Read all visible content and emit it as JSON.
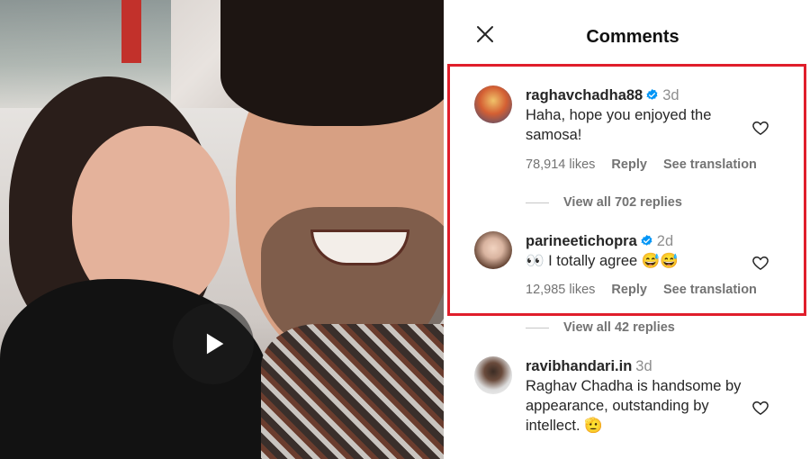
{
  "panel": {
    "title": "Comments"
  },
  "comments": [
    {
      "username": "raghavchadha88",
      "time": "3d",
      "text": "Haha, hope you enjoyed the samosa!",
      "likes": "78,914 likes",
      "reply": "Reply",
      "see_translation": "See translation",
      "view_replies": "View all 702 replies",
      "verified": true
    },
    {
      "username": "parineetichopra",
      "time": "2d",
      "text": "👀 I totally agree 😅😅",
      "likes": "12,985 likes",
      "reply": "Reply",
      "see_translation": "See translation",
      "view_replies": "View all 42 replies",
      "verified": true
    },
    {
      "username": "ravibhandari.in",
      "time": "3d",
      "text": "Raghav Chadha is handsome by appearance, outstanding by intellect. 🫡",
      "verified": false
    }
  ],
  "colors": {
    "highlight": "#e01e2b",
    "verified": "#0095f6",
    "meta": "#737373"
  },
  "icons": {
    "close": "close-icon",
    "play": "play-icon",
    "heart": "heart-icon",
    "verified": "verified-badge-icon"
  }
}
